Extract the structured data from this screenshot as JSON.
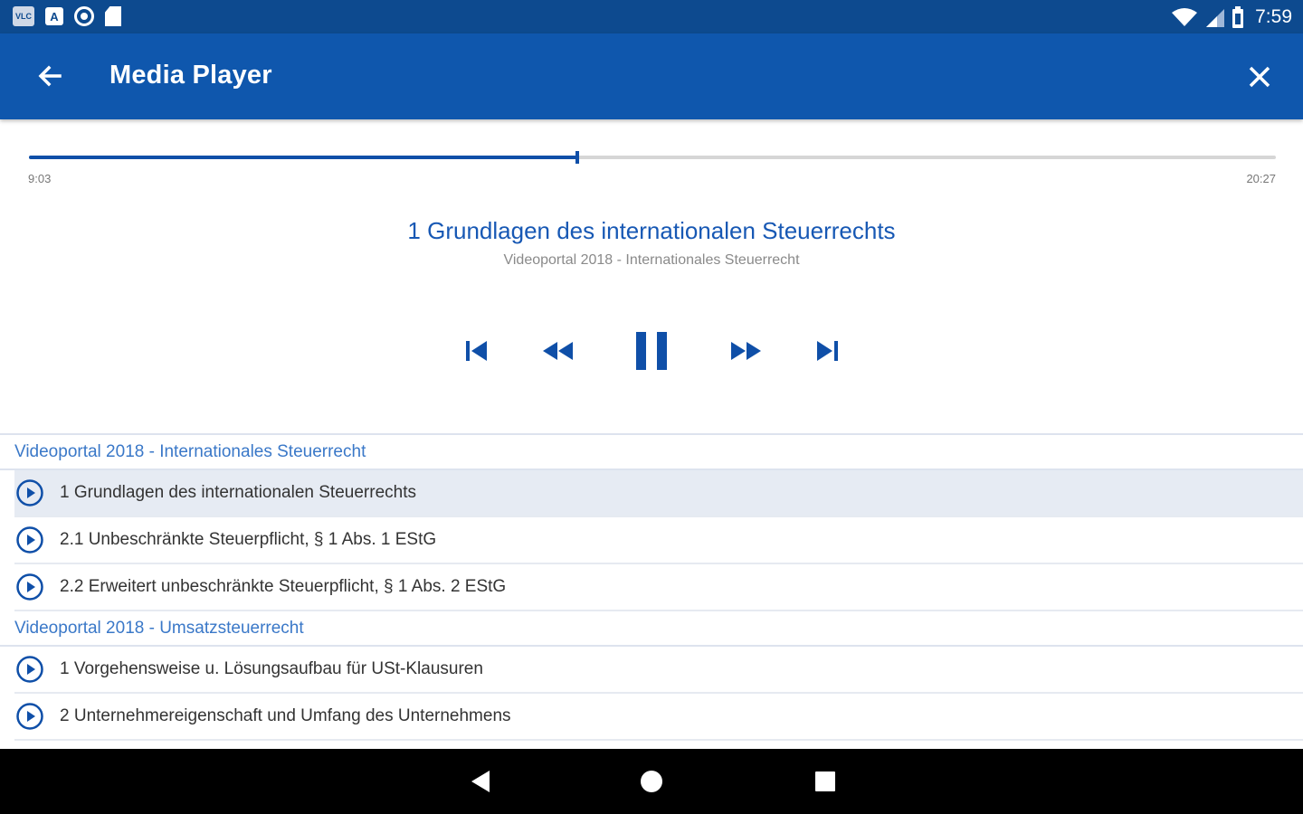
{
  "status_bar": {
    "time": "7:59",
    "badge_text": "VLC",
    "icons": [
      "vlc-icon",
      "app-a-icon",
      "record-icon",
      "sd-card-icon",
      "wifi-icon",
      "signal-icon",
      "battery-icon"
    ]
  },
  "app_bar": {
    "title": "Media Player",
    "back_icon": "arrow-back-icon",
    "close_icon": "close-icon",
    "background": "#0f57ad"
  },
  "player": {
    "elapsed": "9:03",
    "total": "20:27",
    "progress": 0.44,
    "title": "1 Grundlagen des internationalen Steuerrechts",
    "subtitle": "Videoportal 2018 - Internationales Steuerrecht",
    "state": "playing",
    "accent_color": "#0f4fa8"
  },
  "playlist": {
    "groups": [
      {
        "title": "Videoportal 2018 - Internationales Steuerrecht",
        "tracks": [
          {
            "label": "1 Grundlagen des internationalen Steuerrechts",
            "active": true
          },
          {
            "label": "2.1 Unbeschränkte Steuerpflicht, § 1 Abs. 1 EStG",
            "active": false
          },
          {
            "label": "2.2 Erweitert unbeschränkte Steuerpflicht, § 1 Abs. 2 EStG",
            "active": false
          }
        ]
      },
      {
        "title": "Videoportal 2018 - Umsatzsteuerrecht",
        "tracks": [
          {
            "label": "1 Vorgehensweise u. Lösungsaufbau für USt-Klausuren",
            "active": false
          },
          {
            "label": "2 Unternehmereigenschaft und Umfang des Unternehmens",
            "active": false
          }
        ]
      }
    ]
  },
  "nav_bar": {
    "icons": [
      "nav-back-icon",
      "nav-home-icon",
      "nav-recents-icon"
    ]
  }
}
